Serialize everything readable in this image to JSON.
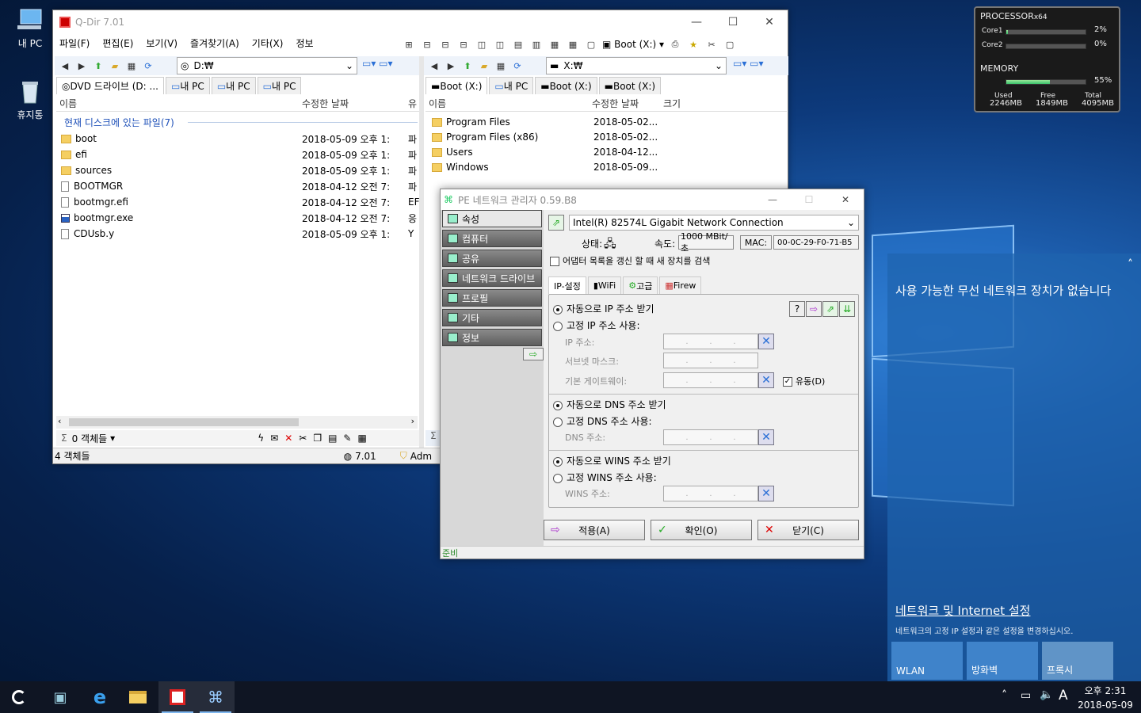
{
  "desktop": {
    "icons": [
      {
        "label": "내 PC"
      },
      {
        "label": "휴지통"
      }
    ]
  },
  "monitor": {
    "processor_label": "PROCESSOR",
    "arch": "x64",
    "cores": [
      {
        "name": "Core1",
        "pct": "2%",
        "value": 0.02
      },
      {
        "name": "Core2",
        "pct": "0%",
        "value": 0.0
      }
    ],
    "memory_label": "MEMORY",
    "memory_pct": "55%",
    "memory_value": 0.55,
    "used_label": "Used",
    "used": "2246MB",
    "free_label": "Free",
    "free": "1849MB",
    "total_label": "Total",
    "total": "4095MB"
  },
  "qdir": {
    "title": "Q-Dir 7.01",
    "menu": [
      "파일(F)",
      "편집(E)",
      "보기(V)",
      "즐겨찾기(A)",
      "기타(X)",
      "정보"
    ],
    "drive_button": "Boot (X:)",
    "left": {
      "address": "D:₩",
      "tabs": [
        "DVD 드라이브 (D: ...",
        "내 PC",
        "내 PC",
        "내 PC"
      ],
      "columns": [
        "이름",
        "수정한 날짜",
        "유"
      ],
      "group_label": "현재 디스크에 있는 파일(7)",
      "files": [
        {
          "name": "boot",
          "date": "2018-05-09 오후 1:",
          "type": "파",
          "kind": "folder"
        },
        {
          "name": "efi",
          "date": "2018-05-09 오후 1:",
          "type": "파",
          "kind": "folder"
        },
        {
          "name": "sources",
          "date": "2018-05-09 오후 1:",
          "type": "파",
          "kind": "folder"
        },
        {
          "name": "BOOTMGR",
          "date": "2018-04-12 오전 7:",
          "type": "파",
          "kind": "file"
        },
        {
          "name": "bootmgr.efi",
          "date": "2018-04-12 오전 7:",
          "type": "EF",
          "kind": "file"
        },
        {
          "name": "bootmgr.exe",
          "date": "2018-04-12 오전 7:",
          "type": "응",
          "kind": "exe"
        },
        {
          "name": "CDUsb.y",
          "date": "2018-05-09 오후 1:",
          "type": "Y",
          "kind": "file"
        }
      ],
      "count_label": "0 객체들"
    },
    "right": {
      "address": "X:₩",
      "tabs": [
        "Boot (X:)",
        "내 PC",
        "Boot (X:)",
        "Boot (X:)"
      ],
      "columns": [
        "이름",
        "수정한 날짜",
        "크기"
      ],
      "files": [
        {
          "name": "Program Files",
          "date": "2018-05-02..."
        },
        {
          "name": "Program Files (x86)",
          "date": "2018-05-02..."
        },
        {
          "name": "Users",
          "date": "2018-04-12..."
        },
        {
          "name": "Windows",
          "date": "2018-05-09..."
        }
      ]
    },
    "status": {
      "objects": "4 객체들",
      "version": "7.01",
      "user": "Adm"
    }
  },
  "pe": {
    "title": "PE 네트워크 관리자 0.59.B8",
    "nav": [
      "속성",
      "컴퓨터",
      "공유",
      "네트워크 드라이브",
      "프로필",
      "기타",
      "정보"
    ],
    "adapter": "Intel(R) 82574L Gigabit Network Connection",
    "state_label": "상태:",
    "speed_label": "속도:",
    "speed": "1000 MBit/초",
    "mac_label": "MAC:",
    "mac": "00-0C-29-F0-71-B5",
    "refresh_label": "어댑터 목록을 갱신 할 때 새 장치를 검색",
    "tabs": [
      "IP-설정",
      "WiFi",
      "고급",
      "Firew"
    ],
    "ip_auto": "자동으로 IP 주소 받기",
    "ip_static": "고정 IP 주소 사용:",
    "ip_label": "IP 주소:",
    "mask_label": "서브넷 마스크:",
    "gw_label": "기본 게이트웨이:",
    "dynamic_label": "유동(D)",
    "dns_auto": "자동으로 DNS 주소 받기",
    "dns_static": "고정 DNS 주소 사용:",
    "dns_label": "DNS 주소:",
    "wins_auto": "자동으로 WINS 주소 받기",
    "wins_static": "고정 WINS 주소 사용:",
    "wins_label": "WINS 주소:",
    "apply": "적용(A)",
    "ok": "확인(O)",
    "close": "닫기(C)",
    "status": "준비"
  },
  "network_panel": {
    "no_wifi": "사용 가능한 무선 네트워크 장치가 없습니다",
    "settings_link": "네트워크 및 Internet 설정",
    "settings_desc": "네트워크의 고정 IP 설정과 같은 설정을 변경하십시오.",
    "tiles": [
      "WLAN",
      "방화벽",
      "프록시"
    ]
  },
  "taskbar": {
    "time": "오후 2:31",
    "date": "2018-05-09",
    "ime": "A"
  }
}
